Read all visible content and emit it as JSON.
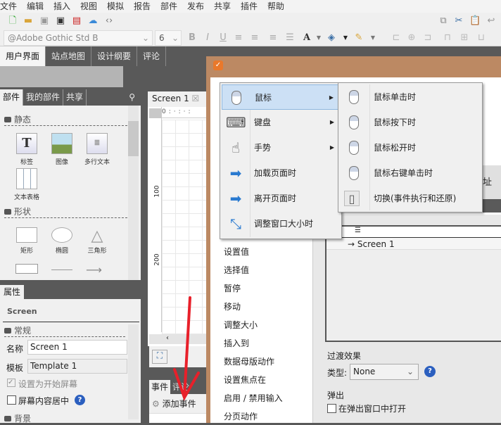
{
  "menubar": [
    "文件",
    "编辑",
    "插入",
    "视图",
    "模拟",
    "报告",
    "部件",
    "发布",
    "共享",
    "插件",
    "帮助"
  ],
  "toolbar": {
    "font": "@Adobe Gothic Std B",
    "size": "6"
  },
  "tabs": [
    "用户界面",
    "站点地图",
    "设计纲要",
    "评论"
  ],
  "library": {
    "tabs": [
      "部件",
      "我的部件",
      "共享"
    ],
    "section_static": "静态",
    "section_shapes": "形状",
    "widgets": [
      "标签",
      "图像",
      "多行文本",
      "文本表格"
    ],
    "shapes": [
      "矩形",
      "椭圆",
      "三角形"
    ]
  },
  "properties": {
    "tab": "属性",
    "type": "Screen",
    "section": "常规",
    "name_label": "名称",
    "name_value": "Screen 1",
    "template_label": "模板",
    "template_value": "Template 1",
    "start_screen": "设置为开始屏幕",
    "center_content": "屏幕内容居中",
    "background": "背景"
  },
  "canvas": {
    "tab": "Screen 1",
    "ruler": [
      "0",
      "100",
      "200"
    ]
  },
  "events": {
    "tabs": [
      "事件",
      "评论"
    ],
    "add": "添加事件"
  },
  "context_menu": {
    "items": [
      "鼠标",
      "键盘",
      "手势",
      "加载页面时",
      "离开页面时",
      "调整窗口大小时"
    ]
  },
  "submenu": {
    "items": [
      "鼠标单击时",
      "鼠标按下时",
      "鼠标松开时",
      "鼠标右键单击时",
      "切换(事件执行和还原)"
    ]
  },
  "dialog": {
    "actions": [
      "设置值",
      "选择值",
      "暂停",
      "移动",
      "调整大小",
      "插入到",
      "数据母版动作",
      "设置焦点在",
      "启用 / 禁用输入",
      "分页动作"
    ],
    "address_fragment": "址",
    "tree_item": "Screen 1",
    "transition": "过渡效果",
    "type_label": "类型:",
    "type_value": "None",
    "popup": "弹出",
    "open_popup": "在弹出窗口中打开"
  },
  "colors": {
    "dialog_frame": "#bc8963",
    "annotation_arrow": "#e8202a",
    "menu_highlight": "#cce0f5"
  }
}
